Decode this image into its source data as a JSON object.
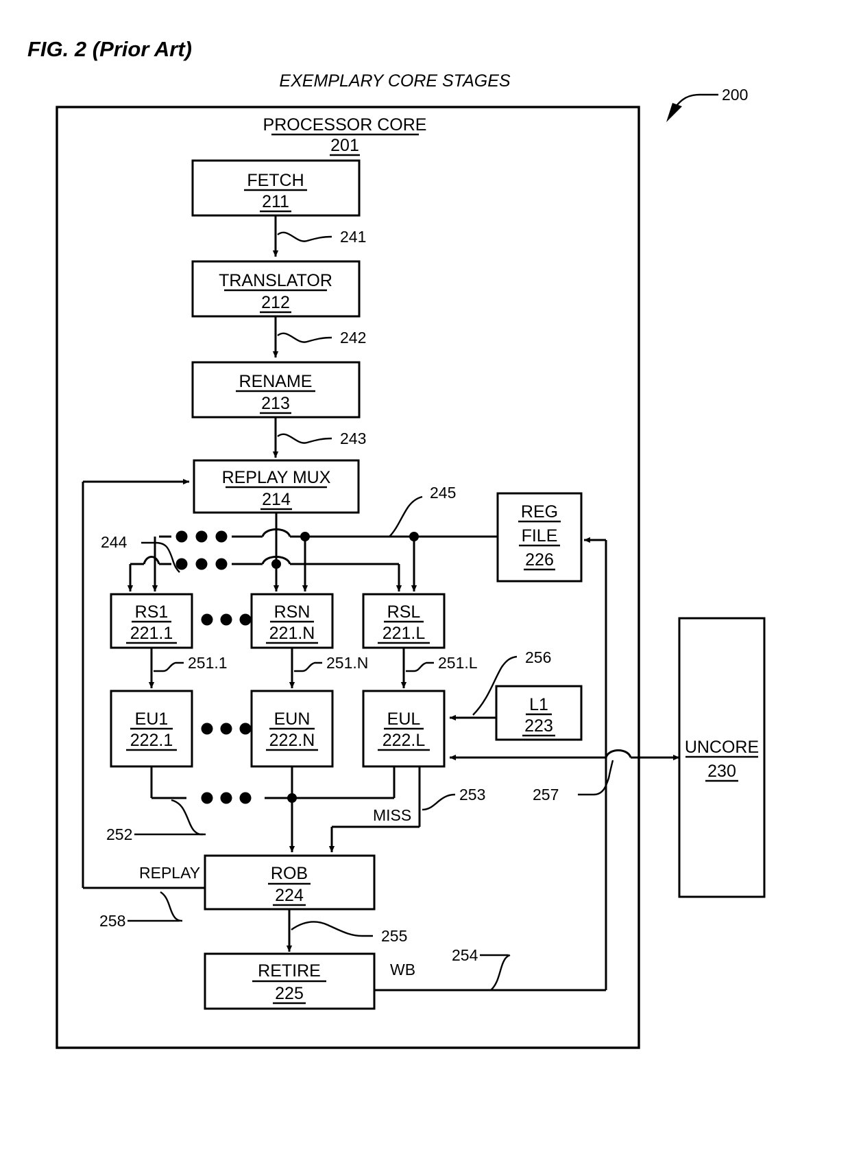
{
  "figure": {
    "caption": "FIG. 2 (Prior Art)",
    "title": "EXEMPLARY CORE STAGES",
    "overall_ref": "200"
  },
  "frame": {
    "core_label": "PROCESSOR CORE",
    "core_ref": "201"
  },
  "boxes": [
    {
      "id": "fetch",
      "label": "FETCH",
      "ref": "211"
    },
    {
      "id": "translator",
      "label": "TRANSLATOR",
      "ref": "212"
    },
    {
      "id": "rename",
      "label": "RENAME",
      "ref": "213"
    },
    {
      "id": "replay_mux",
      "label": "REPLAY MUX",
      "ref": "214"
    },
    {
      "id": "reg_file",
      "label": "REG",
      "label2": "FILE",
      "ref": "226"
    },
    {
      "id": "rs1",
      "label": "RS1",
      "ref": "221.1"
    },
    {
      "id": "rsn",
      "label": "RSN",
      "ref": "221.N"
    },
    {
      "id": "rsl",
      "label": "RSL",
      "ref": "221.L"
    },
    {
      "id": "eu1",
      "label": "EU1",
      "ref": "222.1"
    },
    {
      "id": "eun",
      "label": "EUN",
      "ref": "222.N"
    },
    {
      "id": "eul",
      "label": "EUL",
      "ref": "222.L"
    },
    {
      "id": "l1",
      "label": "L1",
      "ref": "223"
    },
    {
      "id": "rob",
      "label": "ROB",
      "ref": "224"
    },
    {
      "id": "retire",
      "label": "RETIRE",
      "ref": "225"
    },
    {
      "id": "uncore",
      "label": "UNCORE",
      "ref": "230"
    }
  ],
  "signal_refs": [
    {
      "id": "r241",
      "text": "241"
    },
    {
      "id": "r242",
      "text": "242"
    },
    {
      "id": "r243",
      "text": "243"
    },
    {
      "id": "r244",
      "text": "244"
    },
    {
      "id": "r245",
      "text": "245"
    },
    {
      "id": "r251_1",
      "text": "251.1"
    },
    {
      "id": "r251_N",
      "text": "251.N"
    },
    {
      "id": "r251_L",
      "text": "251.L"
    },
    {
      "id": "r252",
      "text": "252"
    },
    {
      "id": "r253",
      "text": "253"
    },
    {
      "id": "r254",
      "text": "254"
    },
    {
      "id": "r255",
      "text": "255"
    },
    {
      "id": "r256",
      "text": "256"
    },
    {
      "id": "r257",
      "text": "257"
    },
    {
      "id": "r258",
      "text": "258"
    }
  ],
  "signal_labels": [
    {
      "id": "miss",
      "text": "MISS"
    },
    {
      "id": "replay",
      "text": "REPLAY"
    },
    {
      "id": "wb",
      "text": "WB"
    }
  ],
  "colors": {
    "stroke": "#000000",
    "background": "#ffffff"
  }
}
